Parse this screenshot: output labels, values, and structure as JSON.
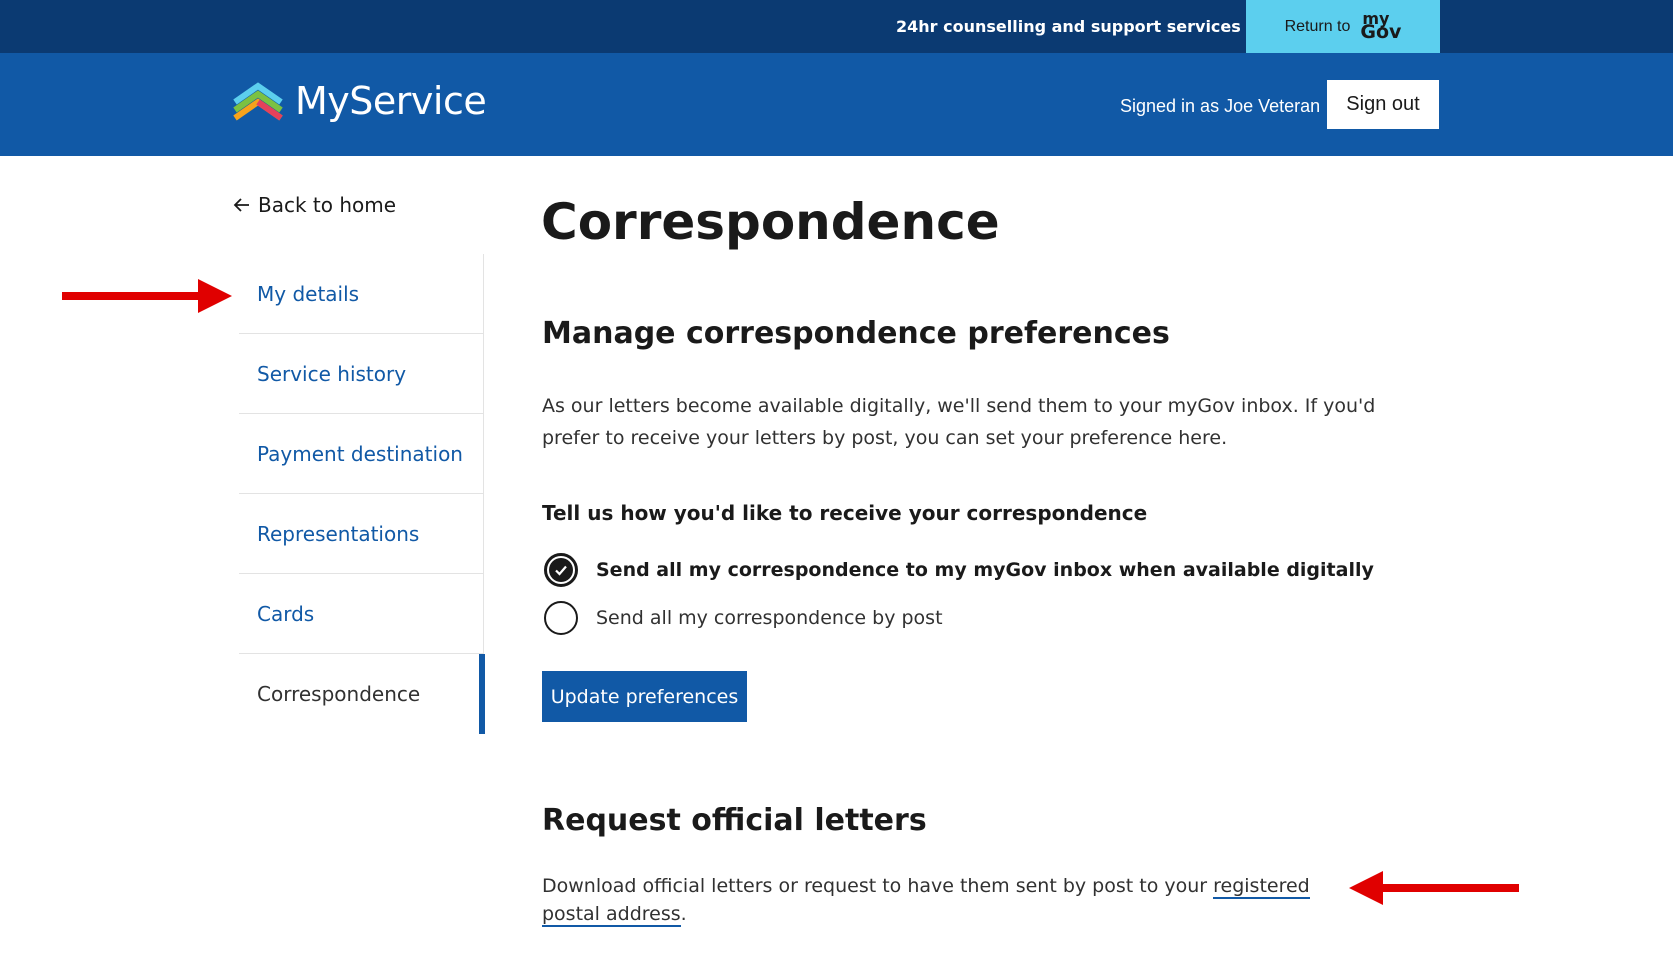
{
  "topbar": {
    "support_label": "24hr counselling and support services",
    "return_label": "Return to",
    "mygov_my": "my",
    "mygov_gov": "Gov"
  },
  "header": {
    "logo_text": "MyService",
    "signed_in_text": "Signed in as Joe Veteran",
    "sign_out_label": "Sign out"
  },
  "sidebar": {
    "back_label": "Back to home",
    "items": [
      {
        "label": "My details"
      },
      {
        "label": "Service history"
      },
      {
        "label": "Payment destination"
      },
      {
        "label": "Representations"
      },
      {
        "label": "Cards"
      },
      {
        "label": "Correspondence"
      }
    ]
  },
  "main": {
    "title": "Correspondence",
    "section1_heading": "Manage correspondence preferences",
    "intro": "As our letters become available digitally, we'll send them to your myGov inbox. If you'd prefer to receive your letters by post, you can set your preference here.",
    "legend": "Tell us how you'd like to receive your correspondence",
    "options": [
      {
        "label": "Send all my correspondence to my myGov inbox when available digitally",
        "checked": true
      },
      {
        "label": "Send all my correspondence by post",
        "checked": false
      }
    ],
    "update_label": "Update preferences",
    "section2_heading": "Request official letters",
    "letters_text_before": "Download official letters or request to have them sent by post to your ",
    "letters_link": "registered postal address",
    "letters_text_after": "."
  },
  "colors": {
    "topbar": "#0b3a72",
    "header": "#1159a6",
    "mygov_button": "#5ccfee",
    "annotation_arrow": "#e00000"
  }
}
